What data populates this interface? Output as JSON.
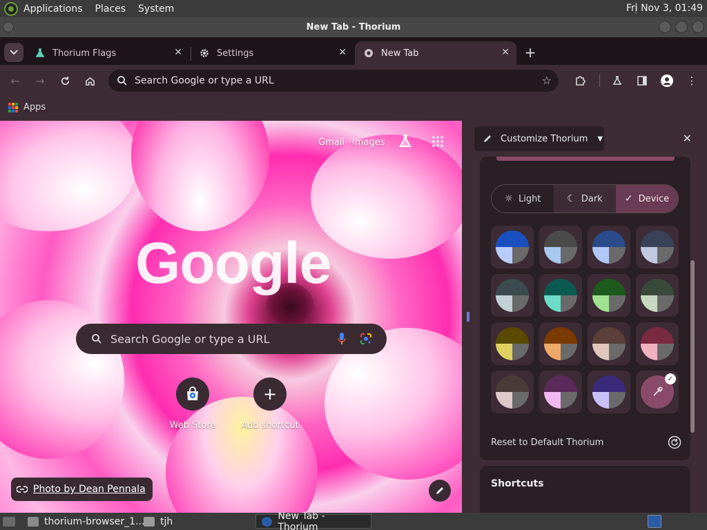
{
  "system_bar": {
    "menus": [
      "Applications",
      "Places",
      "System"
    ],
    "clock": "Fri Nov 3, 01:49"
  },
  "window": {
    "title": "New Tab - Thorium"
  },
  "tabs": [
    {
      "label": "Thorium Flags",
      "icon": "flask-icon"
    },
    {
      "label": "Settings",
      "icon": "gear-icon"
    },
    {
      "label": "New Tab",
      "icon": "chromium-icon",
      "active": true
    }
  ],
  "toolbar": {
    "omnibox_placeholder": "Search Google or type a URL"
  },
  "bookmarks": {
    "apps_label": "Apps"
  },
  "ntp": {
    "gmail": "Gmail",
    "images": "Images",
    "logo": "Google",
    "search_placeholder": "Search Google or type a URL",
    "shortcuts": [
      {
        "label": "Web Store",
        "icon": "web-store-icon"
      },
      {
        "label": "Add shortcut",
        "icon": "plus-icon"
      }
    ],
    "photo_credit": "Photo by Dean Pennala"
  },
  "side_panel": {
    "title": "Customize Thorium",
    "modes": [
      {
        "label": "Light",
        "icon": "sun-icon"
      },
      {
        "label": "Dark",
        "icon": "moon-icon"
      },
      {
        "label": "Device",
        "icon": "check-icon",
        "selected": true
      }
    ],
    "swatches": [
      {
        "top": "#1a4fbf",
        "bl": "#b8ccff",
        "br": "#6a6a6a"
      },
      {
        "top": "#4a4a4a",
        "bl": "#a8c8f0",
        "br": "#6a6a6a"
      },
      {
        "top": "#2a4a8a",
        "bl": "#b0c8f8",
        "br": "#6a6a6a"
      },
      {
        "top": "#3a4258",
        "bl": "#c0c8e0",
        "br": "#6a6a6a"
      },
      {
        "top": "#3a4a4e",
        "bl": "#c0d0d4",
        "br": "#6a6a6a"
      },
      {
        "top": "#0a5a52",
        "bl": "#6adcc8",
        "br": "#6a6a6a"
      },
      {
        "top": "#1e5a1e",
        "bl": "#a0e090",
        "br": "#6a6a6a"
      },
      {
        "top": "#3a4a3a",
        "bl": "#c8d8c0",
        "br": "#6a6a6a"
      },
      {
        "top": "#5a4a00",
        "bl": "#e0d060",
        "br": "#6a6a6a"
      },
      {
        "top": "#7a3a00",
        "bl": "#f0a868",
        "br": "#6a6a6a"
      },
      {
        "top": "#5a4038",
        "bl": "#e0c8bc",
        "br": "#6a6a6a"
      },
      {
        "top": "#7a2a40",
        "bl": "#f0b0c0",
        "br": "#6a6a6a"
      },
      {
        "top": "#4a3a3a",
        "bl": "#e0c8c8",
        "br": "#6a6a6a"
      },
      {
        "top": "#5a2a5a",
        "bl": "#f0b8f0",
        "br": "#6a6a6a"
      },
      {
        "top": "#3a2a7a",
        "bl": "#c8c0f8",
        "br": "#6a6a6a"
      }
    ],
    "custom_swatch_color": "#8a4a6a",
    "reset_label": "Reset to Default Thorium",
    "shortcuts_heading": "Shortcuts"
  },
  "taskbar": {
    "items": [
      {
        "label": "thorium-browser_1..."
      },
      {
        "label": "tjh"
      },
      {
        "label": "New Tab - Thorium",
        "active": true
      }
    ]
  },
  "colors": {
    "panel_bg": "#3d2c35",
    "accent": "#6a3b55",
    "toolbar_bg": "#3d2c35",
    "tabstrip_bg": "#1d1519"
  }
}
